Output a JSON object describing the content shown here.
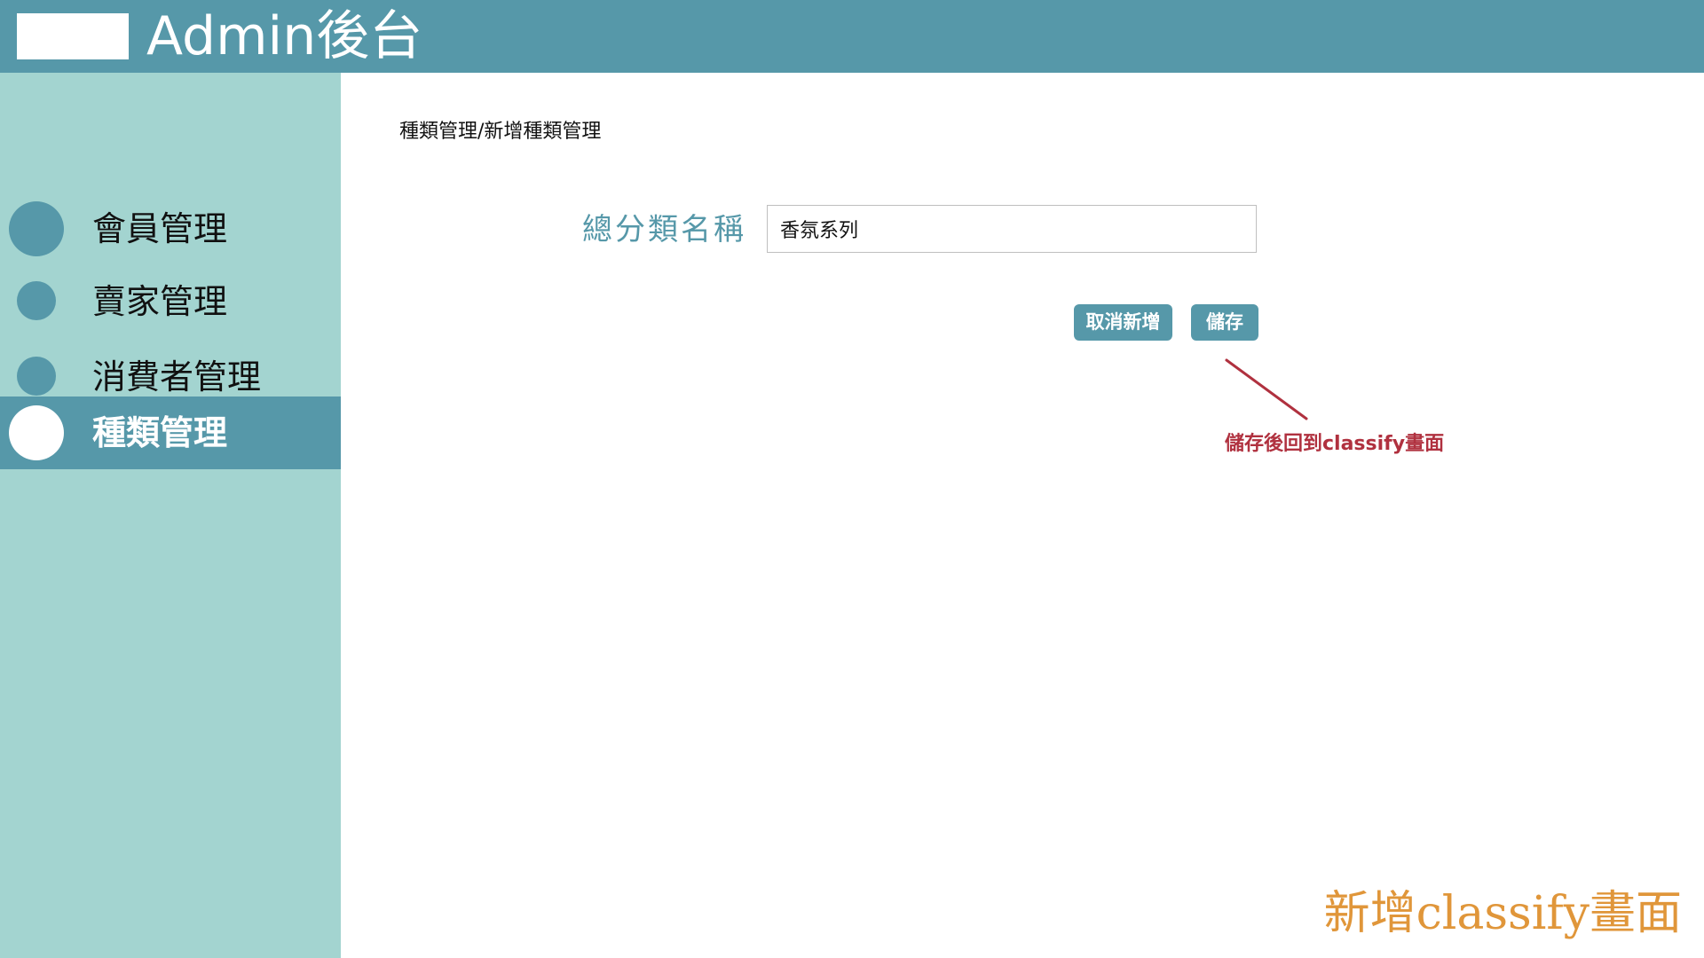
{
  "header": {
    "title": "Admin後台",
    "logo": "logo-placeholder"
  },
  "sidebar": {
    "items": [
      {
        "label": "會員管理",
        "active": false
      },
      {
        "label": "賣家管理",
        "active": false
      },
      {
        "label": "消費者管理",
        "active": false
      },
      {
        "label": "種類管理",
        "active": true
      }
    ]
  },
  "main": {
    "breadcrumb": "種類管理/新增種類管理",
    "form": {
      "field_label": "總分類名稱",
      "field_value": "香氛系列"
    },
    "buttons": {
      "cancel": "取消新增",
      "save": "儲存"
    },
    "annotation": "儲存後回到classify畫面",
    "page_caption": "新增classify畫面"
  },
  "colors": {
    "header_bg": "#5698a9",
    "sidebar_bg": "#a3d4d0",
    "active_item_bg": "#5698a9",
    "button_bg": "#5698a9",
    "label_text": "#5698a9",
    "annotation": "#b0313f",
    "caption": "#e0963a"
  }
}
